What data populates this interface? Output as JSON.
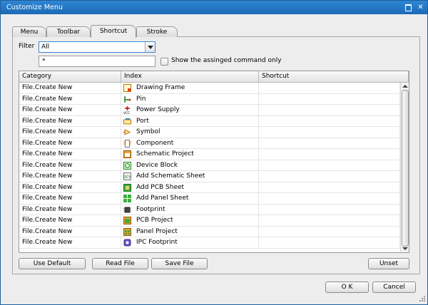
{
  "window": {
    "title": "Customize Menu",
    "colors": {
      "titlebar": "#2f86d3",
      "focus": "#3a86d0"
    }
  },
  "tabs": [
    {
      "label": "Menu"
    },
    {
      "label": "Toolbar"
    },
    {
      "label": "Shortcut"
    },
    {
      "label": "Stroke"
    }
  ],
  "filter": {
    "label": "Filter",
    "value": "All",
    "pattern": "*",
    "show_assigned_label": "Show the assinged command only",
    "show_assigned_checked": false
  },
  "grid": {
    "columns": [
      "Category",
      "Index",
      "Shortcut"
    ],
    "rows": [
      {
        "category": "File.Create New",
        "index": "Drawing Frame",
        "shortcut": "",
        "icon": "drawing-frame-icon"
      },
      {
        "category": "File.Create New",
        "index": "Pin",
        "shortcut": "",
        "icon": "pin-icon"
      },
      {
        "category": "File.Create New",
        "index": "Power Supply",
        "shortcut": "",
        "icon": "power-supply-icon"
      },
      {
        "category": "File.Create New",
        "index": "Port",
        "shortcut": "",
        "icon": "port-icon"
      },
      {
        "category": "File.Create New",
        "index": "Symbol",
        "shortcut": "",
        "icon": "symbol-icon"
      },
      {
        "category": "File.Create New",
        "index": "Component",
        "shortcut": "",
        "icon": "component-icon"
      },
      {
        "category": "File.Create New",
        "index": "Schematic Project",
        "shortcut": "",
        "icon": "schematic-project-icon"
      },
      {
        "category": "File.Create New",
        "index": "Device Block",
        "shortcut": "",
        "icon": "device-block-icon"
      },
      {
        "category": "File.Create New",
        "index": "Add Schematic Sheet",
        "shortcut": "",
        "icon": "schematic-sheet-icon"
      },
      {
        "category": "File.Create New",
        "index": "Add PCB Sheet",
        "shortcut": "",
        "icon": "pcb-sheet-icon"
      },
      {
        "category": "File.Create New",
        "index": "Add Panel Sheet",
        "shortcut": "",
        "icon": "panel-sheet-icon"
      },
      {
        "category": "File.Create New",
        "index": "Footprint",
        "shortcut": "",
        "icon": "footprint-icon"
      },
      {
        "category": "File.Create New",
        "index": "PCB Project",
        "shortcut": "",
        "icon": "pcb-project-icon"
      },
      {
        "category": "File.Create New",
        "index": "Panel Project",
        "shortcut": "",
        "icon": "panel-project-icon"
      },
      {
        "category": "File.Create New",
        "index": "IPC Footprint",
        "shortcut": "",
        "icon": "ipc-footprint-icon"
      }
    ]
  },
  "buttons": {
    "use_default": "Use Default",
    "read_file": "Read File",
    "save_file": "Save File",
    "unset": "Unset",
    "ok": "O K",
    "cancel": "Cancel"
  }
}
